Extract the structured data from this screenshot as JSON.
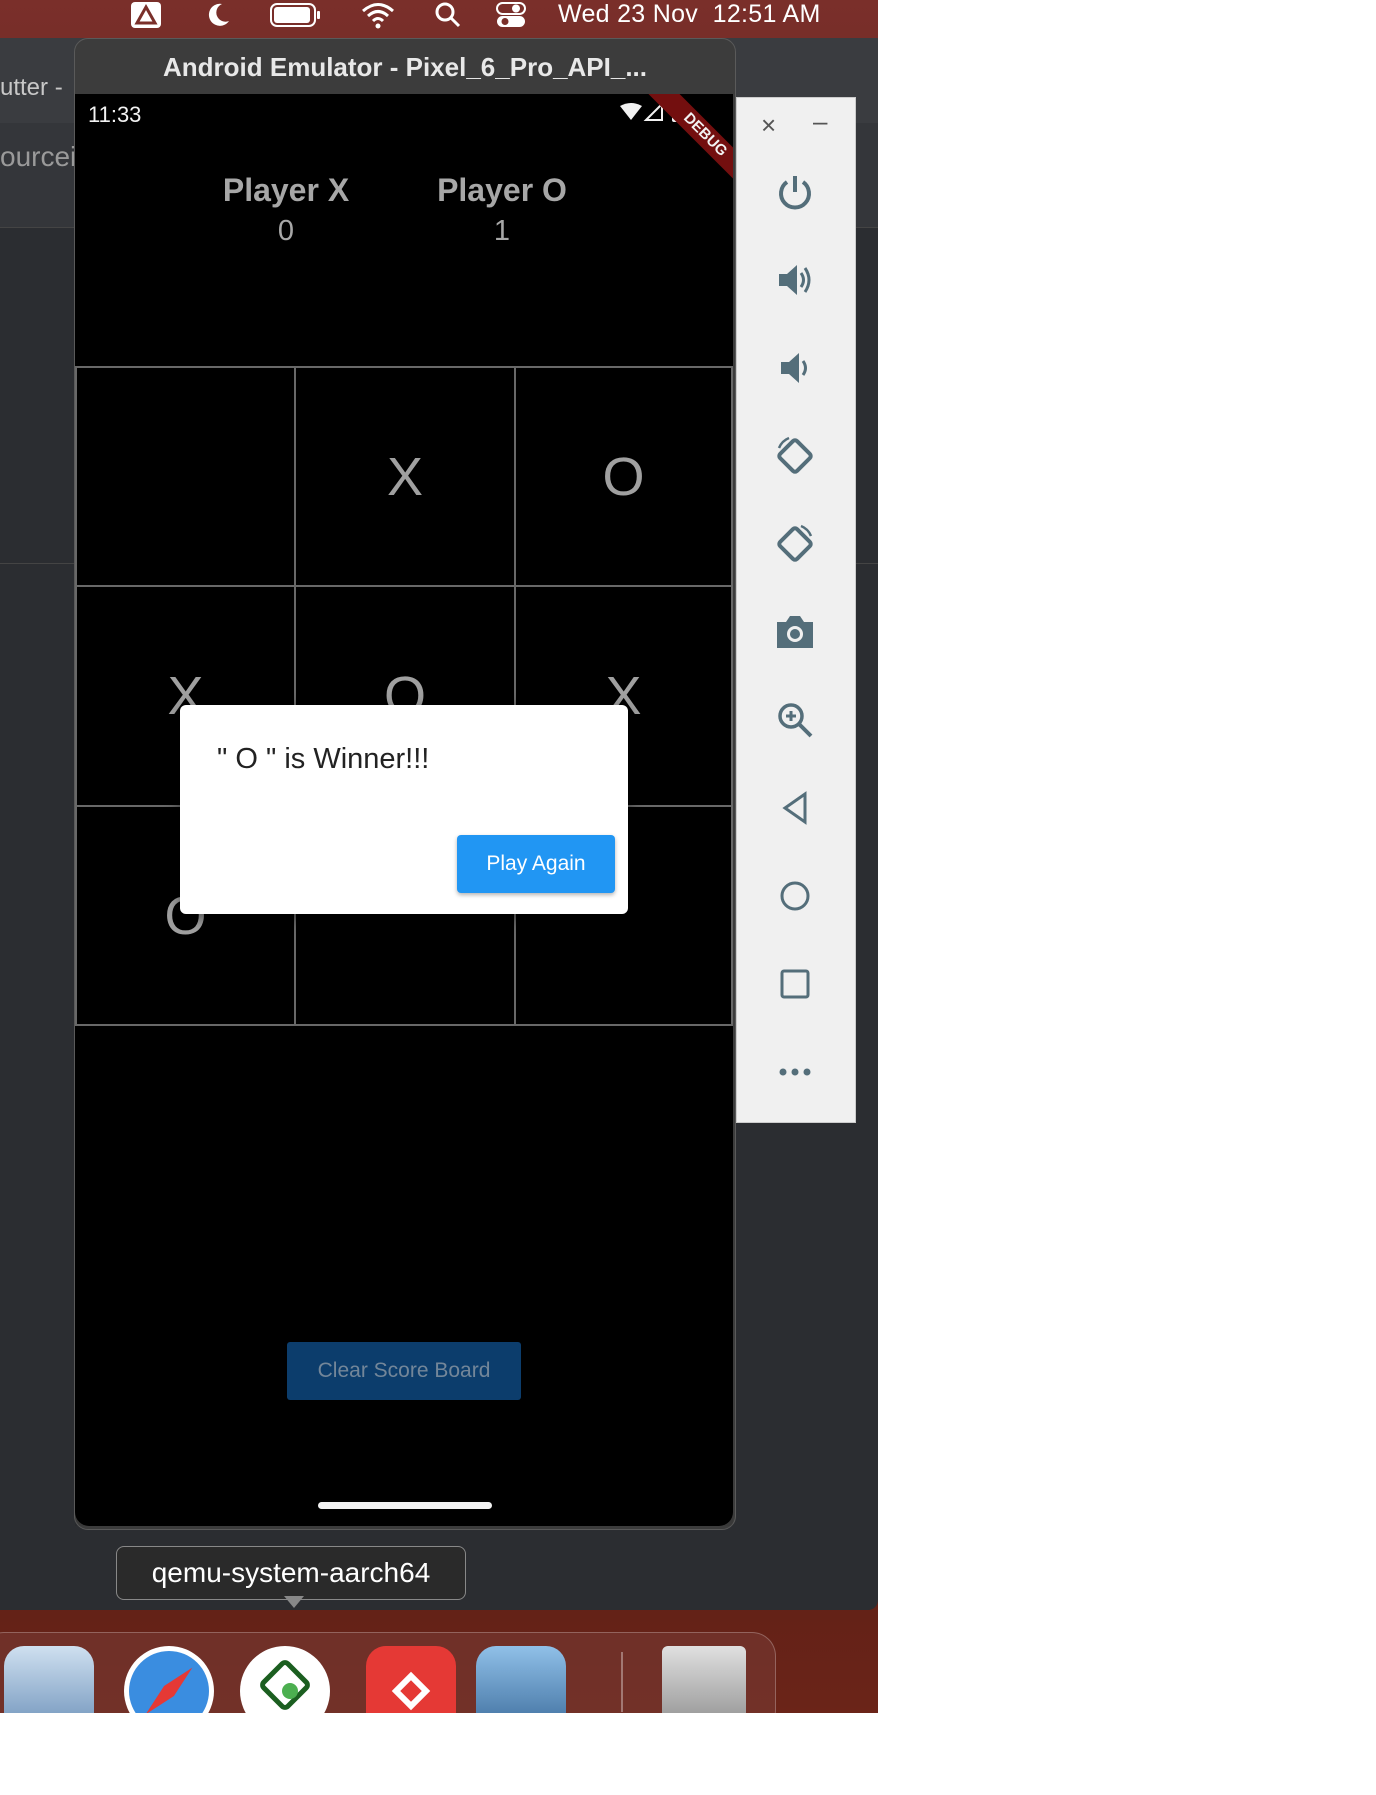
{
  "menubar": {
    "date": "Wed 23 Nov",
    "time": "12:51 AM",
    "icons": [
      "drive-icon",
      "moon-icon",
      "battery-icon",
      "wifi-icon",
      "search-icon",
      "control-center-icon"
    ]
  },
  "ide": {
    "title_fragment": "utter -",
    "tab_fragment": "ourcei"
  },
  "emulator": {
    "title": "Android Emulator - Pixel_6_Pro_API_...",
    "status_time": "11:33",
    "debug_banner": "DEBUG"
  },
  "game": {
    "players": [
      {
        "name": "Player X",
        "score": "0"
      },
      {
        "name": "Player O",
        "score": "1"
      }
    ],
    "board": [
      "",
      "X",
      "O",
      "X",
      "O",
      "X",
      "O",
      "",
      ""
    ],
    "clear_button": "Clear Score Board"
  },
  "dialog": {
    "message": "\" O \" is Winner!!!",
    "button": "Play Again"
  },
  "toolbar": {
    "buttons": [
      "power-icon",
      "volume-up-icon",
      "volume-down-icon",
      "rotate-left-icon",
      "rotate-right-icon",
      "camera-icon",
      "zoom-icon",
      "back-icon",
      "home-icon",
      "overview-icon",
      "more-icon"
    ]
  },
  "tooltip": "qemu-system-aarch64",
  "dock": {
    "apps": [
      "finder-icon",
      "safari-icon",
      "android-studio-icon",
      "anydesk-icon",
      "preview-icon",
      "trash-icon"
    ]
  },
  "colors": {
    "accent": "#2196f3",
    "clear_button_bg": "#0d4172",
    "toolbar_icon": "#546e7a"
  }
}
